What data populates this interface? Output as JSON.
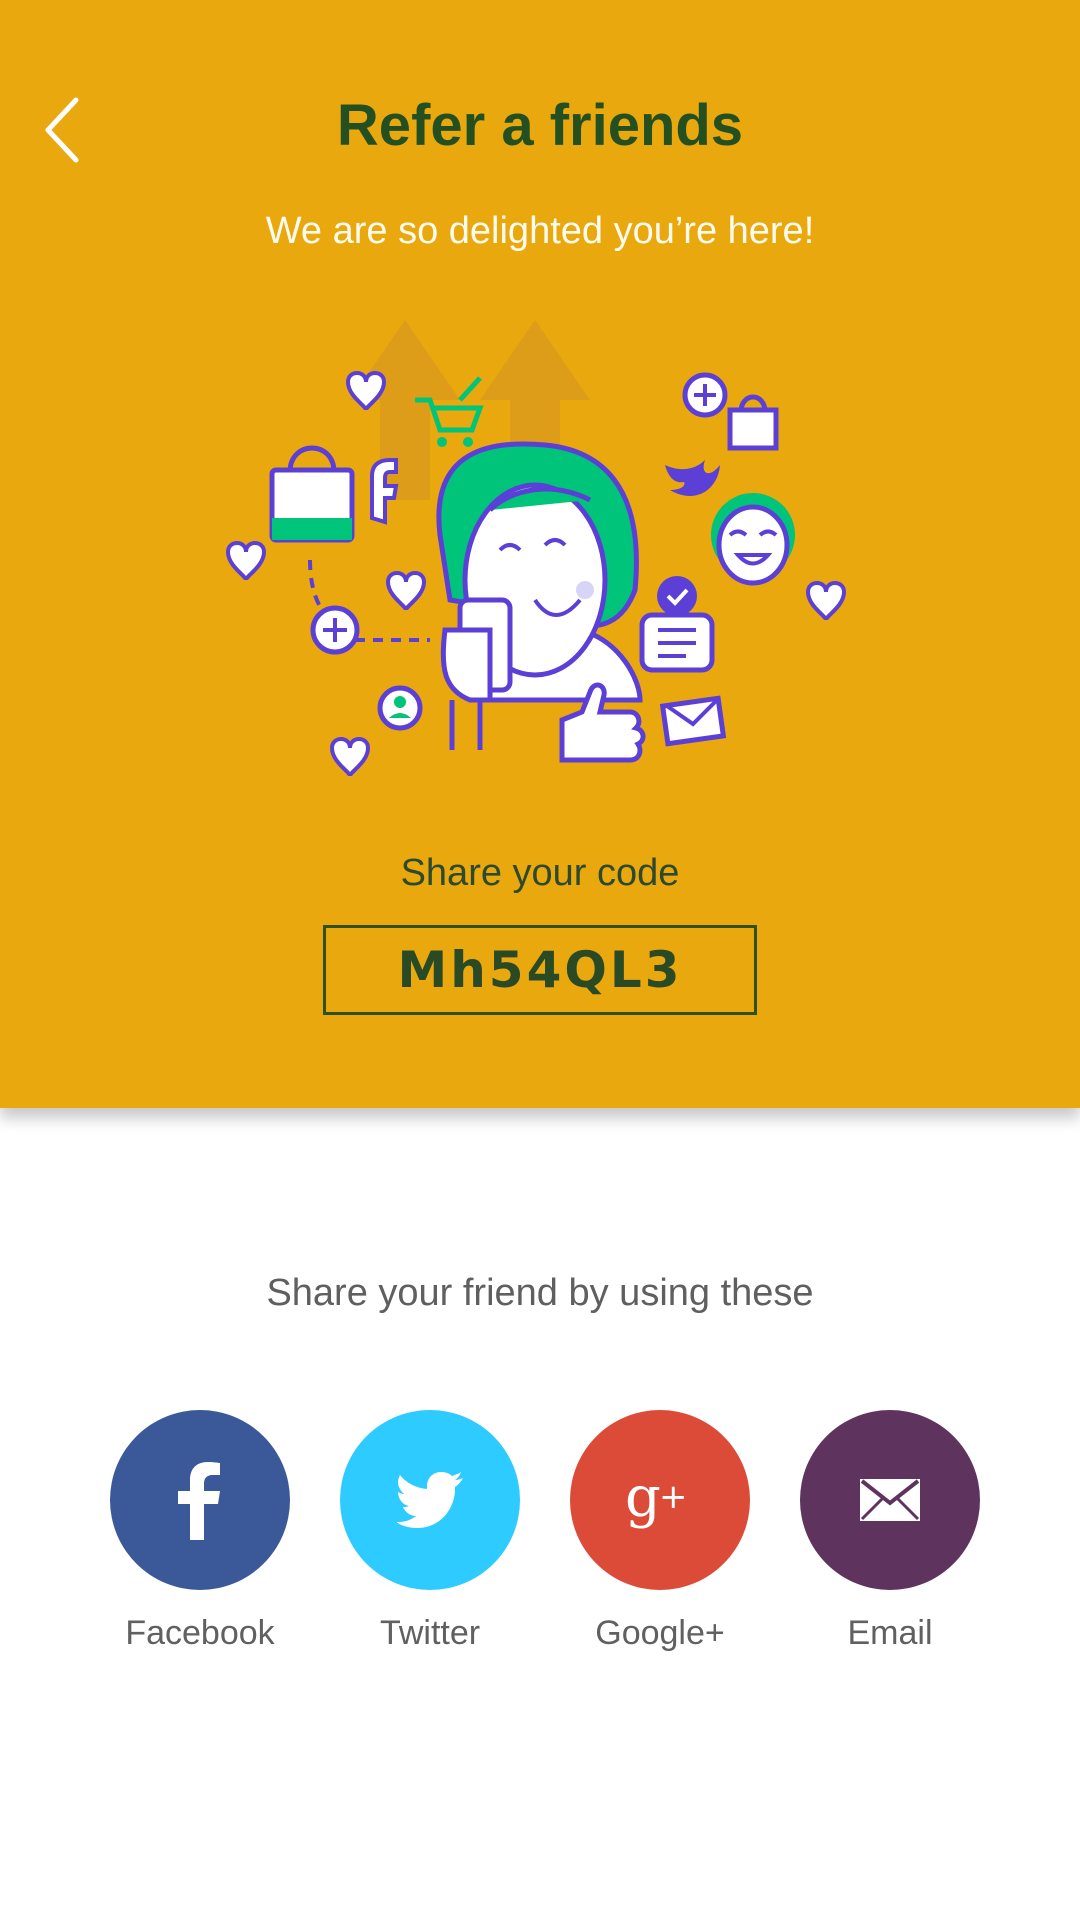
{
  "header": {
    "title": "Refer a friends",
    "subtitle": "We are so delighted you’re here!",
    "background": "#E8A80E",
    "back_icon": "chevron-left-icon"
  },
  "referral": {
    "label": "Share your code",
    "code": "Mh54QL3"
  },
  "share": {
    "heading": "Share your friend by using these",
    "options": [
      {
        "label": "Facebook",
        "icon": "facebook-icon",
        "color": "#3B5998"
      },
      {
        "label": "Twitter",
        "icon": "twitter-icon",
        "color": "#2DCBFF"
      },
      {
        "label": "Google+",
        "icon": "google-plus-icon",
        "color": "#DC4A38"
      },
      {
        "label": "Email",
        "icon": "mail-icon",
        "color": "#5E335E"
      }
    ]
  },
  "colors": {
    "title": "#245021",
    "illustration_purple": "#5B3FD6",
    "illustration_green": "#00C47A"
  }
}
